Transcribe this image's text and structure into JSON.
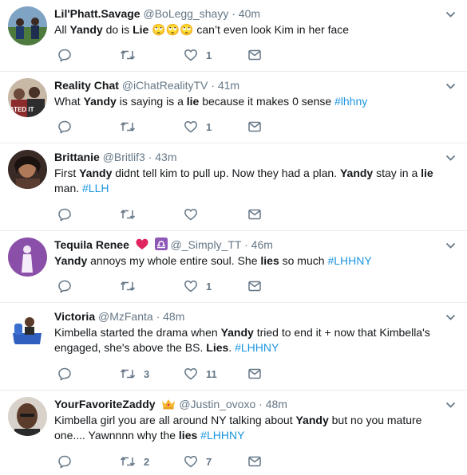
{
  "tweets": [
    {
      "name": "Lil'Phatt.Savage",
      "handle": "@BoLegg_shayy",
      "time": "40m",
      "segments": [
        {
          "t": "All ",
          "s": "n"
        },
        {
          "t": "Yandy",
          "s": "b"
        },
        {
          "t": " do is ",
          "s": "n"
        },
        {
          "t": "Lie",
          "s": "b"
        },
        {
          "t": " 🙄🙄🙄",
          "s": "n"
        },
        {
          "t": " can’t even look Kim in her face",
          "s": "n"
        }
      ],
      "replies": "",
      "retweets": "",
      "likes": "1"
    },
    {
      "name": "Reality Chat",
      "handle": "@iChatRealityTV",
      "time": "41m",
      "segments": [
        {
          "t": "What ",
          "s": "n"
        },
        {
          "t": "Yandy",
          "s": "b"
        },
        {
          "t": " is saying is a ",
          "s": "n"
        },
        {
          "t": "lie",
          "s": "b"
        },
        {
          "t": " because it makes  0 sense ",
          "s": "n"
        },
        {
          "t": "#lhhny",
          "s": "h"
        }
      ],
      "replies": "",
      "retweets": "",
      "likes": "1",
      "avatar_text": "ATED IT"
    },
    {
      "name": "Brittanie",
      "handle": "@Britlif3",
      "time": "43m",
      "segments": [
        {
          "t": "First ",
          "s": "n"
        },
        {
          "t": "Yandy",
          "s": "b"
        },
        {
          "t": " didnt tell kim to pull up. Now they had a plan. ",
          "s": "n"
        },
        {
          "t": "Yandy",
          "s": "b"
        },
        {
          "t": " stay in a ",
          "s": "n"
        },
        {
          "t": "lie",
          "s": "b"
        },
        {
          "t": " man. ",
          "s": "n"
        },
        {
          "t": "#LLH",
          "s": "h"
        }
      ],
      "replies": "",
      "retweets": "",
      "likes": ""
    },
    {
      "name": "Tequila Renee",
      "handle": "@_Simply_TT",
      "time": "46m",
      "badge": "heart-libra",
      "segments": [
        {
          "t": "Yandy",
          "s": "b"
        },
        {
          "t": " annoys my whole entire soul. She ",
          "s": "n"
        },
        {
          "t": "lies",
          "s": "b"
        },
        {
          "t": " so much ",
          "s": "n"
        },
        {
          "t": "#LHHNY",
          "s": "h"
        }
      ],
      "replies": "",
      "retweets": "",
      "likes": "1"
    },
    {
      "name": "Victoria",
      "handle": "@MzFanta",
      "time": "48m",
      "segments": [
        {
          "t": "Kimbella started the drama when ",
          "s": "n"
        },
        {
          "t": "Yandy",
          "s": "b"
        },
        {
          "t": " tried to end it + now that Kimbella's engaged, she's above the BS. ",
          "s": "n"
        },
        {
          "t": "Lies",
          "s": "b"
        },
        {
          "t": ". ",
          "s": "n"
        },
        {
          "t": "#LHHNY",
          "s": "h"
        }
      ],
      "replies": "",
      "retweets": "3",
      "likes": "11"
    },
    {
      "name": "YourFavoriteZaddy",
      "handle": "@Justin_ovoxo",
      "time": "48m",
      "badge": "crown",
      "segments": [
        {
          "t": "Kimbella girl you are all around NY talking about ",
          "s": "n"
        },
        {
          "t": "Yandy",
          "s": "b"
        },
        {
          "t": " but no you mature one.... Yawnnnn why the ",
          "s": "n"
        },
        {
          "t": "lies",
          "s": "b"
        },
        {
          "t": " ",
          "s": "n"
        },
        {
          "t": "#LHHNY",
          "s": "h"
        }
      ],
      "replies": "",
      "retweets": "2",
      "likes": "7"
    }
  ],
  "icons": {
    "reply": "reply-icon",
    "retweet": "retweet-icon",
    "like": "heart-icon",
    "dm": "direct-message-icon",
    "caret": "chevron-down-icon"
  },
  "colors": {
    "text": "#14171a",
    "muted": "#657786",
    "link": "#1b95e0",
    "divider": "#e6ecf0",
    "heart_badge": "#e0245e",
    "libra_badge": "#8e58b6",
    "crown_badge": "#f5b731"
  }
}
